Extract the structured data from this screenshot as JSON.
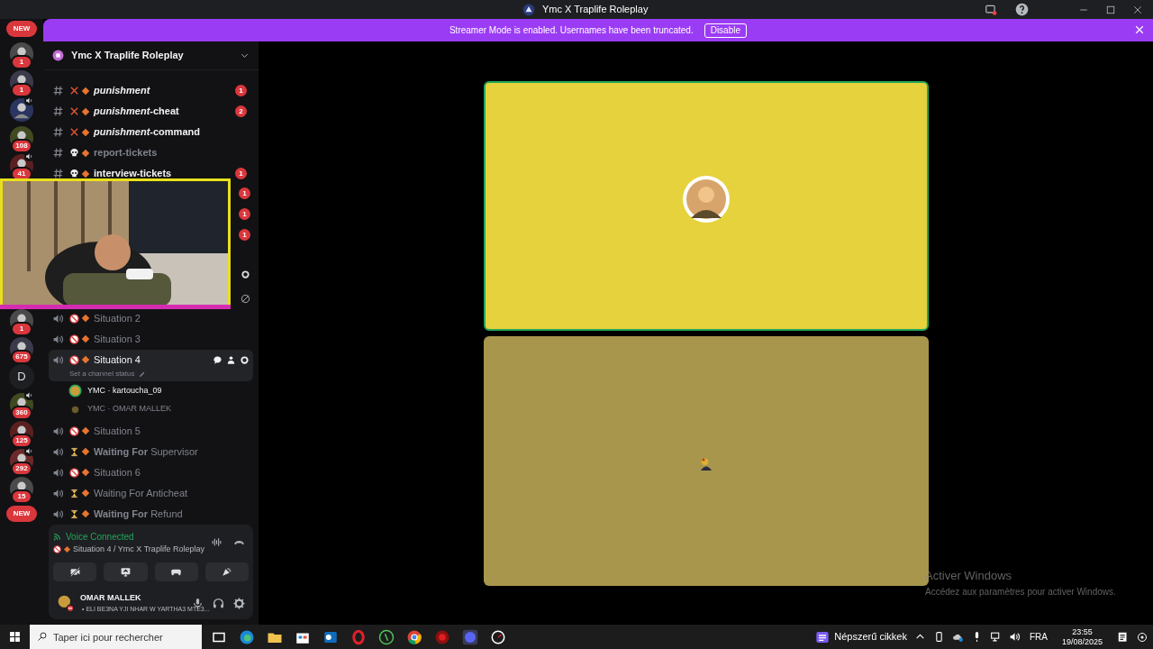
{
  "window": {
    "title": "Ymc X Traplife Roleplay"
  },
  "banner": {
    "text": "Streamer Mode is enabled. Usernames have been truncated.",
    "button": "Disable"
  },
  "rail": [
    {
      "kind": "pill",
      "label": "NEW"
    },
    {
      "kind": "server",
      "badge": "1",
      "speaker": false
    },
    {
      "kind": "server",
      "badge": "1",
      "speaker": false
    },
    {
      "kind": "server",
      "speaker": true
    },
    {
      "kind": "server",
      "badge": "108",
      "speaker": false
    },
    {
      "kind": "server",
      "badge": "41",
      "speaker": true
    },
    {
      "kind": "gap"
    },
    {
      "kind": "server",
      "badge": "1",
      "speaker": false
    },
    {
      "kind": "server",
      "badge": "675",
      "speaker": false
    },
    {
      "kind": "letter",
      "label": "D"
    },
    {
      "kind": "server",
      "badge": "360",
      "speaker": true
    },
    {
      "kind": "server",
      "badge": "125",
      "speaker": false
    },
    {
      "kind": "server",
      "badge": "292",
      "speaker": true
    },
    {
      "kind": "server",
      "badge": "15",
      "speaker": false
    },
    {
      "kind": "pill",
      "label": "NEW"
    }
  ],
  "server": {
    "name": "Ymc X Traplife Roleplay"
  },
  "channels": [
    {
      "kind": "text",
      "icon": {
        "kind": "cross"
      },
      "name": "*punishment*",
      "unread": true,
      "badge": "1",
      "selected": false
    },
    {
      "kind": "text",
      "icon": {
        "kind": "cross"
      },
      "name": "*punishment*-cheat",
      "unread": true,
      "badge": "2",
      "selected": false
    },
    {
      "kind": "text",
      "icon": {
        "kind": "cross"
      },
      "name": "*punishment*-command",
      "unread": true,
      "selected": false
    },
    {
      "kind": "text",
      "icon": {
        "kind": "skull"
      },
      "name": "report-tickets",
      "unread": false,
      "selected": false
    },
    {
      "kind": "text",
      "icon": {
        "kind": "skull"
      },
      "name": "interview-tickets",
      "unread": true,
      "badge": "1",
      "selected": false
    },
    {
      "kind": "covered",
      "badges": [
        "1",
        "1",
        "1"
      ]
    },
    {
      "kind": "voice",
      "icon": {
        "kind": "blocked"
      },
      "name": "Situation 2",
      "unread": false,
      "selected": false
    },
    {
      "kind": "voice",
      "icon": {
        "kind": "blocked"
      },
      "name": "Situation 3",
      "unread": false,
      "selected": false
    },
    {
      "kind": "voice",
      "icon": {
        "kind": "blocked"
      },
      "name": "Situation 4",
      "unread": true,
      "selected": true,
      "status": "Set a channel status",
      "members": [
        {
          "name": "YMC · kartoucha_09",
          "speaking": true
        },
        {
          "name": "YMC · OMAR MALLEK",
          "speaking": false
        }
      ]
    },
    {
      "kind": "voice",
      "icon": {
        "kind": "blocked"
      },
      "name": "Situation 5",
      "unread": false,
      "selected": false
    },
    {
      "kind": "voice",
      "icon": {
        "kind": "hourglass"
      },
      "name": "**Waiting For** Supervisor",
      "unread": false,
      "selected": false
    },
    {
      "kind": "voice",
      "icon": {
        "kind": "blocked"
      },
      "name": "Situation 6",
      "unread": false,
      "selected": false
    },
    {
      "kind": "voice",
      "icon": {
        "kind": "hourglass"
      },
      "name": "Waiting For Anticheat",
      "unread": false,
      "selected": false
    },
    {
      "kind": "voice",
      "icon": {
        "kind": "hourglass"
      },
      "name": "**Waiting For** Refund",
      "unread": false,
      "selected": false
    }
  ],
  "voice_panel": {
    "status": "Voice Connected",
    "channel": "Situation 4 / Ymc X Traplife Roleplay"
  },
  "user": {
    "name": "OMAR MALLEK",
    "activity": "• ELI BE3NA YJI NHAR W YARTHA3 MTE3..."
  },
  "stage": {
    "tiles": [
      {
        "kind": "avatar",
        "color": "#e6d23c",
        "speaking": true
      },
      {
        "kind": "small",
        "color": "#a8964d",
        "speaking": false
      }
    ]
  },
  "activation": {
    "title": "Activer Windows",
    "text": "Accédez aux paramètres pour activer Windows."
  },
  "taskbar": {
    "search": {
      "placeholder": "Taper ici pour rechercher"
    },
    "news": "Népszerű cikkek",
    "language": "FRA",
    "time": "23:55",
    "date": "19/08/2025"
  }
}
